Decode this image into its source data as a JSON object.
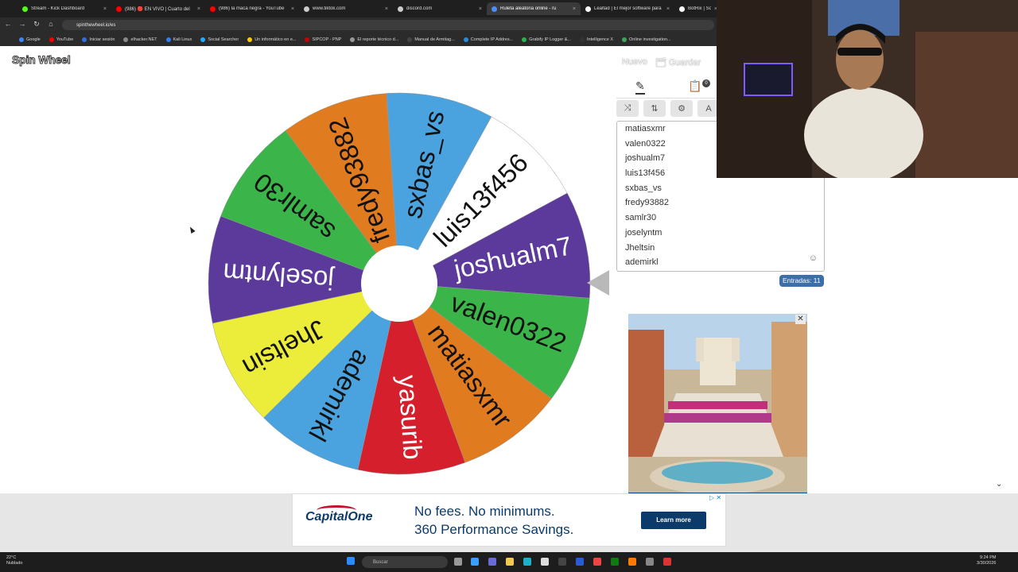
{
  "browser": {
    "tabs": [
      {
        "title": "Stream - Kick Dashboard",
        "color": "#53fc18",
        "active": false
      },
      {
        "title": "(986) 🔴 EN VIVO | Cuarto del",
        "color": "#ff0000",
        "active": false
      },
      {
        "title": "(986) la maca negra - YouTube",
        "color": "#ff0000",
        "active": false
      },
      {
        "title": "www.tiktok.com",
        "color": "#cccccc",
        "active": false
      },
      {
        "title": "discord.com",
        "color": "#cccccc",
        "active": false
      },
      {
        "title": "Ruleta aleatoria online - ru",
        "color": "#4f8df5",
        "active": true
      },
      {
        "title": "Lealtad | El mejor software para",
        "color": "#ffffff",
        "active": false
      },
      {
        "title": "BotRix | Sort",
        "color": "#ffffff",
        "active": false
      }
    ],
    "url": "spinthewheel.io/es",
    "bookmarks": [
      {
        "label": "Google",
        "color": "#4285f4"
      },
      {
        "label": "YouTube",
        "color": "#ff0000"
      },
      {
        "label": "Iniciar sesión",
        "color": "#2f6fde"
      },
      {
        "label": "elhacker.NET",
        "color": "#888888"
      },
      {
        "label": "Kali Linux",
        "color": "#367bf0"
      },
      {
        "label": "Social Searcher",
        "color": "#22aaff"
      },
      {
        "label": "Un informático en e...",
        "color": "#ffcc00"
      },
      {
        "label": "SIPCOP - PNP",
        "color": "#cc0000"
      },
      {
        "label": "El reporte técnico d...",
        "color": "#999999"
      },
      {
        "label": "Manual de Armitag...",
        "color": "#444444"
      },
      {
        "label": "Complete IP Addres...",
        "color": "#2a8adc"
      },
      {
        "label": "Grabify IP Logger &...",
        "color": "#2bb24c"
      },
      {
        "label": "Intelligence X",
        "color": "#333333"
      },
      {
        "label": "Online investigation...",
        "color": "#3ba55c"
      }
    ]
  },
  "app": {
    "logo": "Spin Wheel",
    "new_label": "Nuevo",
    "save_label": "🗂 Guardar"
  },
  "wheel": {
    "segments": [
      {
        "label": "joshualm7",
        "color": "#5b3a9b",
        "text_color": "#ffffff"
      },
      {
        "label": "valen0322",
        "color": "#3bb54a",
        "text_color": "#111111"
      },
      {
        "label": "matiasxmr",
        "color": "#e07b20",
        "text_color": "#111111"
      },
      {
        "label": "yasurib",
        "color": "#d61f2c",
        "text_color": "#ffffff"
      },
      {
        "label": "ademirkl",
        "color": "#4aa3df",
        "text_color": "#111111"
      },
      {
        "label": "Jheltsin",
        "color": "#ecec3a",
        "text_color": "#111111"
      },
      {
        "label": "joselyntm",
        "color": "#5b3a9b",
        "text_color": "#ffffff"
      },
      {
        "label": "samlr30",
        "color": "#3bb54a",
        "text_color": "#111111"
      },
      {
        "label": "fredy93882",
        "color": "#e07b20",
        "text_color": "#111111"
      },
      {
        "label": "sxbas_vs",
        "color": "#4aa3df",
        "text_color": "#111111"
      },
      {
        "label": "luis13f456",
        "color": "#ffffff",
        "text_color": "#111111"
      }
    ]
  },
  "panel": {
    "edit_icon": "pencil-icon",
    "results_icon": "clipboard-icon",
    "results_badge": "0",
    "tools": [
      {
        "name": "shuffle-icon",
        "glyph": "⤨"
      },
      {
        "name": "sort-icon",
        "glyph": "⇅"
      },
      {
        "name": "settings-icon",
        "glyph": "⚙"
      },
      {
        "name": "more-icon",
        "glyph": "A"
      }
    ],
    "entries": [
      "matiasxmr",
      "valen0322",
      "joshualm7",
      "luis13f456",
      "sxbas_vs",
      "fredy93882",
      "samlr30",
      "joselyntm",
      "Jheltsin",
      "ademirkl"
    ],
    "count_label": "Entradas: 11"
  },
  "ads": {
    "bank": "CapitalOne",
    "line1": "No fees. No minimums.",
    "line2": "360 Performance Savings.",
    "cta": "Learn more"
  },
  "taskbar": {
    "weather_temp": "22°C",
    "weather_desc": "Nublado",
    "search_placeholder": "Buscar",
    "time": "9:24 PM",
    "date": "3/30/2026"
  }
}
